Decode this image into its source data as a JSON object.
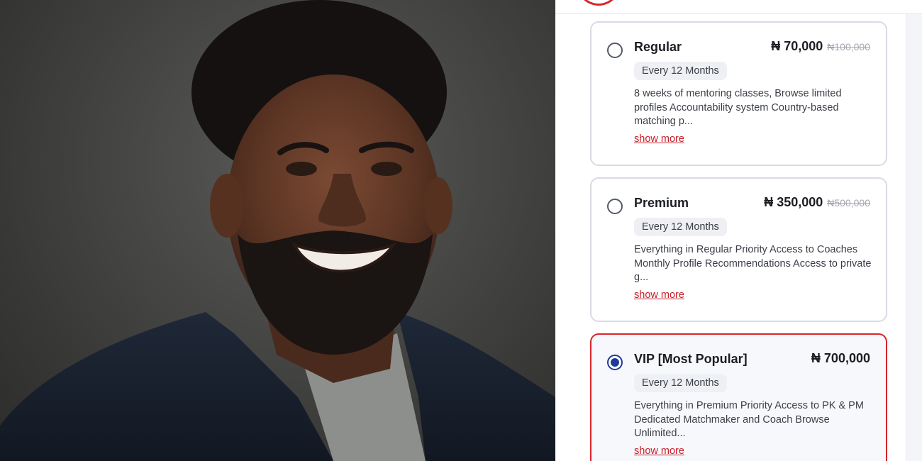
{
  "photo": {
    "subject": "portrait-photo"
  },
  "plans": [
    {
      "name": "Regular",
      "price": "₦ 70,000",
      "original_price": "₦100,000",
      "period": "Every 12 Months",
      "description": "8 weeks of mentoring classes, Browse limited profiles Accountability system Country-based matching p...",
      "show_more": "show more",
      "selected": false
    },
    {
      "name": "Premium",
      "price": "₦ 350,000",
      "original_price": "₦500,000",
      "period": "Every 12 Months",
      "description": "Everything in Regular Priority Access to Coaches Monthly Profile Recommendations Access to private g...",
      "show_more": "show more",
      "selected": false
    },
    {
      "name": "VIP [Most Popular]",
      "price": "₦ 700,000",
      "original_price": "",
      "period": "Every 12 Months",
      "description": "Everything in Premium Priority Access to PK & PM Dedicated Matchmaker and Coach Browse Unlimited...",
      "show_more": "show more",
      "selected": true
    }
  ],
  "colors": {
    "accent_red": "#d8262b",
    "radio_selected": "#1f3c9a",
    "link_red": "#c8202a"
  }
}
